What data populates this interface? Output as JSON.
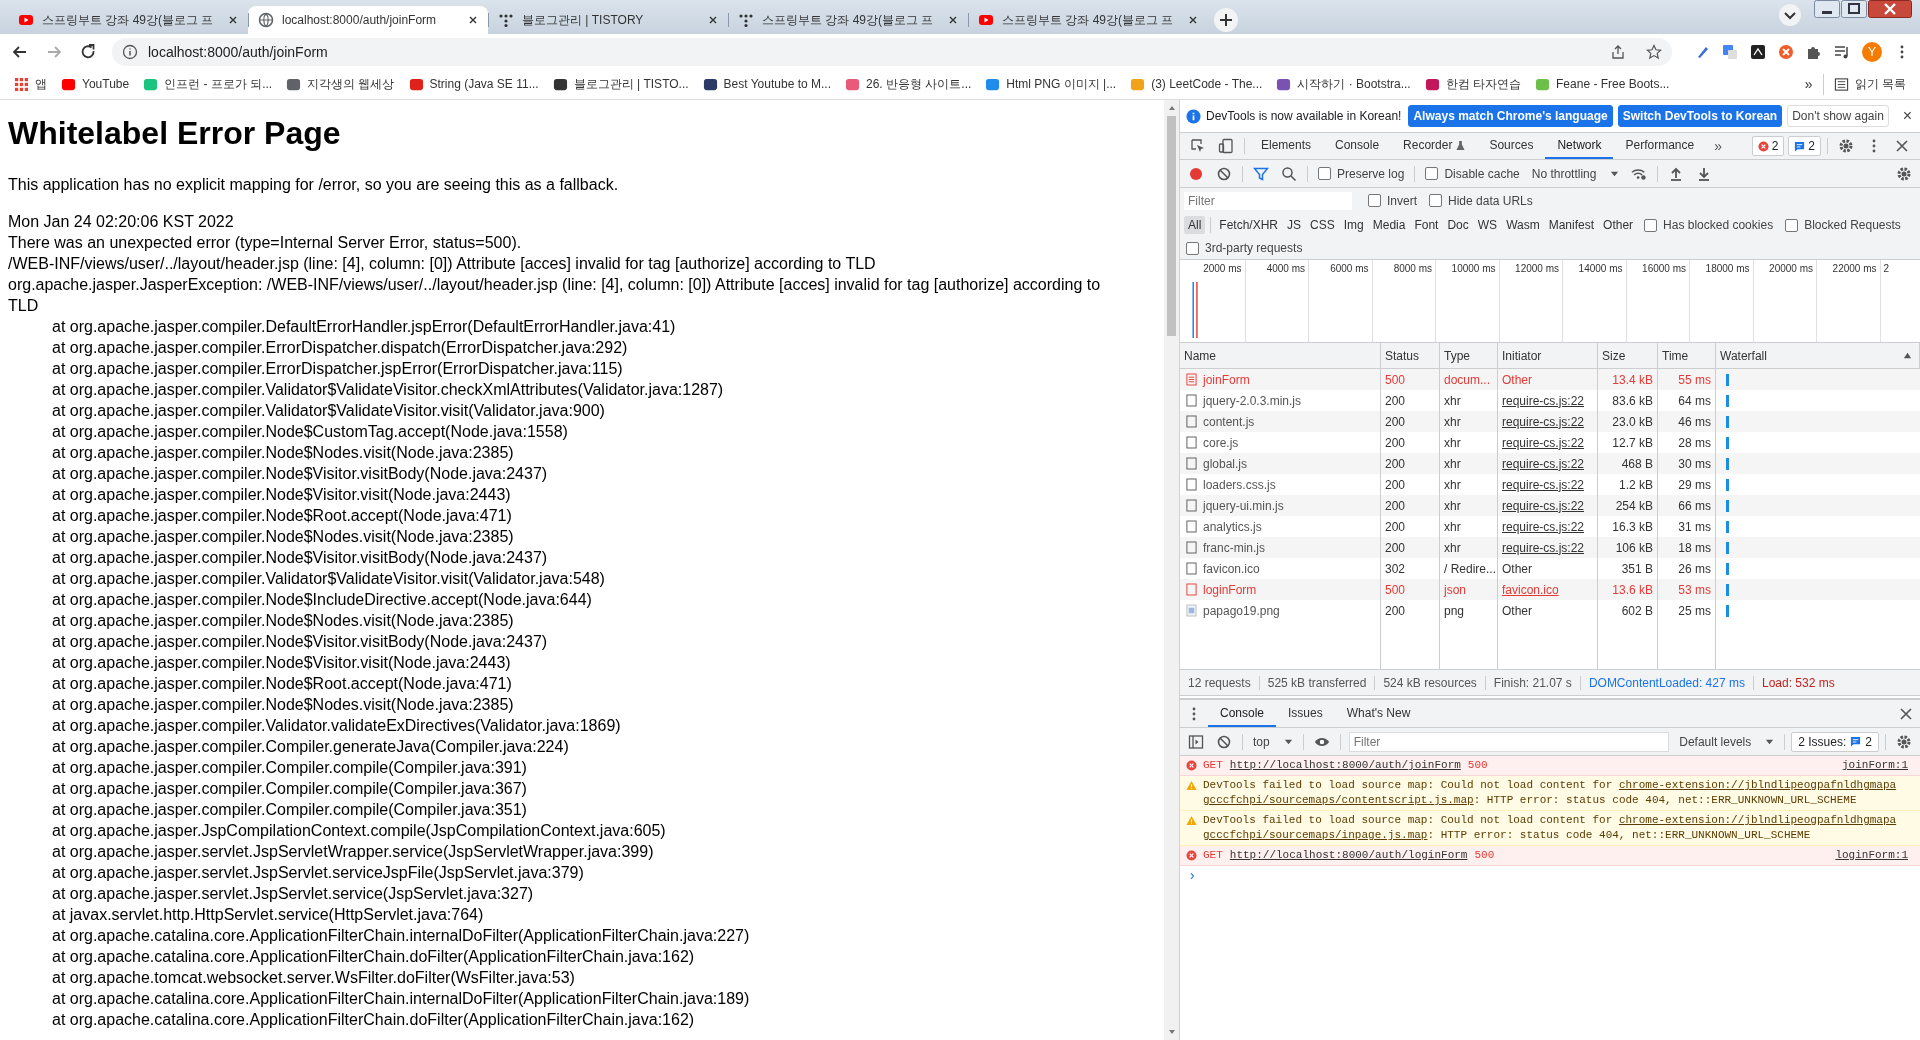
{
  "browser": {
    "tabs": [
      {
        "title": "스프링부트 강좌 49강(블로그 프",
        "kind": "youtube",
        "selected": false
      },
      {
        "title": "localhost:8000/auth/joinForm",
        "kind": "globe",
        "selected": true
      },
      {
        "title": "블로그관리 | TISTORY",
        "kind": "tistory",
        "selected": false
      },
      {
        "title": "스프링부트 강좌 49강(블로그 프",
        "kind": "tistory",
        "selected": false
      },
      {
        "title": "스프링부트 강좌 49강(블로그 프",
        "kind": "youtube",
        "selected": false
      }
    ],
    "address": "localhost:8000/auth/joinForm",
    "avatar": "Y",
    "bookmarks": [
      {
        "label": "앱",
        "kind": "apps",
        "color": "#e94235"
      },
      {
        "label": "YouTube",
        "kind": "site",
        "color": "#ff0000"
      },
      {
        "label": "인프런 - 프로가 되...",
        "kind": "site",
        "color": "#1bc47d"
      },
      {
        "label": "지각생의 웹세상",
        "kind": "site",
        "color": "#5f6368"
      },
      {
        "label": "String (Java SE 11...",
        "kind": "site",
        "color": "#e0201b"
      },
      {
        "label": "블로그관리 | TISTO...",
        "kind": "site",
        "color": "#333333"
      },
      {
        "label": "Best Youtube to M...",
        "kind": "site",
        "color": "#2b3a67"
      },
      {
        "label": "26. 반응형 사이트...",
        "kind": "site",
        "color": "#e8597a"
      },
      {
        "label": "Html PNG 이미지 |...",
        "kind": "site",
        "color": "#1f8ceb"
      },
      {
        "label": "(3) LeetCode - The...",
        "kind": "site",
        "color": "#f0a21b"
      },
      {
        "label": "시작하기 · Bootstra...",
        "kind": "site",
        "color": "#7952b3"
      },
      {
        "label": "한컴 타자연습",
        "kind": "site",
        "color": "#c2185b"
      },
      {
        "label": "Feane - Free Boots...",
        "kind": "site",
        "color": "#6cc04a"
      }
    ],
    "more": "»",
    "reading_list": "읽기 목록"
  },
  "page": {
    "heading": "Whitelabel Error Page",
    "intro": "This application has no explicit mapping for /error, so you are seeing this as a fallback.",
    "lines": [
      "Mon Jan 24 02:20:06 KST 2022",
      "There was an unexpected error (type=Internal Server Error, status=500).",
      "/WEB-INF/views/user/../layout/header.jsp (line: [4], column: [0]) Attribute [acces] invalid for tag [authorize] according to TLD",
      "org.apache.jasper.JasperException: /WEB-INF/views/user/../layout/header.jsp (line: [4], column: [0]) Attribute [acces] invalid for tag [authorize] according to TLD"
    ],
    "stack": [
      "at org.apache.jasper.compiler.DefaultErrorHandler.jspError(DefaultErrorHandler.java:41)",
      "at org.apache.jasper.compiler.ErrorDispatcher.dispatch(ErrorDispatcher.java:292)",
      "at org.apache.jasper.compiler.ErrorDispatcher.jspError(ErrorDispatcher.java:115)",
      "at org.apache.jasper.compiler.Validator$ValidateVisitor.checkXmlAttributes(Validator.java:1287)",
      "at org.apache.jasper.compiler.Validator$ValidateVisitor.visit(Validator.java:900)",
      "at org.apache.jasper.compiler.Node$CustomTag.accept(Node.java:1558)",
      "at org.apache.jasper.compiler.Node$Nodes.visit(Node.java:2385)",
      "at org.apache.jasper.compiler.Node$Visitor.visitBody(Node.java:2437)",
      "at org.apache.jasper.compiler.Node$Visitor.visit(Node.java:2443)",
      "at org.apache.jasper.compiler.Node$Root.accept(Node.java:471)",
      "at org.apache.jasper.compiler.Node$Nodes.visit(Node.java:2385)",
      "at org.apache.jasper.compiler.Node$Visitor.visitBody(Node.java:2437)",
      "at org.apache.jasper.compiler.Validator$ValidateVisitor.visit(Validator.java:548)",
      "at org.apache.jasper.compiler.Node$IncludeDirective.accept(Node.java:644)",
      "at org.apache.jasper.compiler.Node$Nodes.visit(Node.java:2385)",
      "at org.apache.jasper.compiler.Node$Visitor.visitBody(Node.java:2437)",
      "at org.apache.jasper.compiler.Node$Visitor.visit(Node.java:2443)",
      "at org.apache.jasper.compiler.Node$Root.accept(Node.java:471)",
      "at org.apache.jasper.compiler.Node$Nodes.visit(Node.java:2385)",
      "at org.apache.jasper.compiler.Validator.validateExDirectives(Validator.java:1869)",
      "at org.apache.jasper.compiler.Compiler.generateJava(Compiler.java:224)",
      "at org.apache.jasper.compiler.Compiler.compile(Compiler.java:391)",
      "at org.apache.jasper.compiler.Compiler.compile(Compiler.java:367)",
      "at org.apache.jasper.compiler.Compiler.compile(Compiler.java:351)",
      "at org.apache.jasper.JspCompilationContext.compile(JspCompilationContext.java:605)",
      "at org.apache.jasper.servlet.JspServletWrapper.service(JspServletWrapper.java:399)",
      "at org.apache.jasper.servlet.JspServlet.serviceJspFile(JspServlet.java:379)",
      "at org.apache.jasper.servlet.JspServlet.service(JspServlet.java:327)",
      "at javax.servlet.http.HttpServlet.service(HttpServlet.java:764)",
      "at org.apache.catalina.core.ApplicationFilterChain.internalDoFilter(ApplicationFilterChain.java:227)",
      "at org.apache.catalina.core.ApplicationFilterChain.doFilter(ApplicationFilterChain.java:162)",
      "at org.apache.tomcat.websocket.server.WsFilter.doFilter(WsFilter.java:53)",
      "at org.apache.catalina.core.ApplicationFilterChain.internalDoFilter(ApplicationFilterChain.java:189)",
      "at org.apache.catalina.core.ApplicationFilterChain.doFilter(ApplicationFilterChain.java:162)"
    ]
  },
  "devtools": {
    "infobar": {
      "message": "DevTools is now available in Korean!",
      "buttons": [
        {
          "label": "Always match Chrome's language",
          "kind": "primary"
        },
        {
          "label": "Switch DevTools to Korean",
          "kind": "primary"
        },
        {
          "label": "Don't show again",
          "kind": "plain"
        }
      ],
      "close": "×"
    },
    "tabs": [
      {
        "label": "Elements",
        "selected": false
      },
      {
        "label": "Console",
        "selected": false
      },
      {
        "label": "Recorder",
        "selected": false
      },
      {
        "label": "Sources",
        "selected": false
      },
      {
        "label": "Network",
        "selected": true
      },
      {
        "label": "Performance",
        "selected": false
      }
    ],
    "tabs_more": "»",
    "error_count": "2",
    "message_count": "2",
    "toolbar": {
      "preserve_log": {
        "label": "Preserve log",
        "checked": false
      },
      "disable_cache": {
        "label": "Disable cache",
        "checked": false
      },
      "throttling": "No throttling"
    },
    "filter": {
      "placeholder": "Filter",
      "options": [
        {
          "label": "Invert",
          "checked": false
        },
        {
          "label": "Hide data URLs",
          "checked": false
        }
      ]
    },
    "types": [
      {
        "label": "All",
        "selected": true
      },
      {
        "label": "Fetch/XHR",
        "selected": false
      },
      {
        "label": "JS",
        "selected": false
      },
      {
        "label": "CSS",
        "selected": false
      },
      {
        "label": "Img",
        "selected": false
      },
      {
        "label": "Media",
        "selected": false
      },
      {
        "label": "Font",
        "selected": false
      },
      {
        "label": "Doc",
        "selected": false
      },
      {
        "label": "WS",
        "selected": false
      },
      {
        "label": "Wasm",
        "selected": false
      },
      {
        "label": "Manifest",
        "selected": false
      },
      {
        "label": "Other",
        "selected": false
      }
    ],
    "type_options": [
      {
        "label": "Has blocked cookies",
        "checked": false
      },
      {
        "label": "Blocked Requests",
        "checked": false
      }
    ],
    "third_party": {
      "label": "3rd-party requests",
      "checked": false
    },
    "overview_ticks": [
      "2000 ms",
      "4000 ms",
      "6000 ms",
      "8000 ms",
      "10000 ms",
      "12000 ms",
      "14000 ms",
      "16000 ms",
      "18000 ms",
      "20000 ms",
      "22000 ms",
      "2"
    ],
    "table": {
      "columns": [
        "Name",
        "Status",
        "Type",
        "Initiator",
        "Size",
        "Time",
        "Waterfall"
      ],
      "rows": [
        {
          "name": "joinForm",
          "status": "500",
          "type": "docum...",
          "initiator": "Other",
          "initiator_link": false,
          "size": "13.4 kB",
          "time": "55 ms",
          "error": true,
          "kind": "document"
        },
        {
          "name": "jquery-2.0.3.min.js",
          "status": "200",
          "type": "xhr",
          "initiator": "require-cs.js:22",
          "initiator_link": true,
          "size": "83.6 kB",
          "time": "64 ms",
          "error": false,
          "kind": "file"
        },
        {
          "name": "content.js",
          "status": "200",
          "type": "xhr",
          "initiator": "require-cs.js:22",
          "initiator_link": true,
          "size": "23.0 kB",
          "time": "46 ms",
          "error": false,
          "kind": "file"
        },
        {
          "name": "core.js",
          "status": "200",
          "type": "xhr",
          "initiator": "require-cs.js:22",
          "initiator_link": true,
          "size": "12.7 kB",
          "time": "28 ms",
          "error": false,
          "kind": "file"
        },
        {
          "name": "global.js",
          "status": "200",
          "type": "xhr",
          "initiator": "require-cs.js:22",
          "initiator_link": true,
          "size": "468 B",
          "time": "30 ms",
          "error": false,
          "kind": "file"
        },
        {
          "name": "loaders.css.js",
          "status": "200",
          "type": "xhr",
          "initiator": "require-cs.js:22",
          "initiator_link": true,
          "size": "1.2 kB",
          "time": "29 ms",
          "error": false,
          "kind": "file"
        },
        {
          "name": "jquery-ui.min.js",
          "status": "200",
          "type": "xhr",
          "initiator": "require-cs.js:22",
          "initiator_link": true,
          "size": "254 kB",
          "time": "66 ms",
          "error": false,
          "kind": "file"
        },
        {
          "name": "analytics.js",
          "status": "200",
          "type": "xhr",
          "initiator": "require-cs.js:22",
          "initiator_link": true,
          "size": "16.3 kB",
          "time": "31 ms",
          "error": false,
          "kind": "file"
        },
        {
          "name": "franc-min.js",
          "status": "200",
          "type": "xhr",
          "initiator": "require-cs.js:22",
          "initiator_link": true,
          "size": "106 kB",
          "time": "18 ms",
          "error": false,
          "kind": "file"
        },
        {
          "name": "favicon.ico",
          "status": "302",
          "type": "/ Redire...",
          "initiator": "Other",
          "initiator_link": false,
          "size": "351 B",
          "time": "26 ms",
          "error": false,
          "kind": "file"
        },
        {
          "name": "loginForm",
          "status": "500",
          "type": "json",
          "initiator": "favicon.ico",
          "initiator_link": true,
          "size": "13.6 kB",
          "time": "53 ms",
          "error": true,
          "kind": "file"
        },
        {
          "name": "papago19.png",
          "status": "200",
          "type": "png",
          "initiator": "Other",
          "initiator_link": false,
          "size": "602 B",
          "time": "25 ms",
          "error": false,
          "kind": "image"
        }
      ]
    },
    "summary": [
      {
        "text": "12 requests",
        "kind": "plain"
      },
      {
        "text": "525 kB transferred",
        "kind": "plain"
      },
      {
        "text": "524 kB resources",
        "kind": "plain"
      },
      {
        "text": "Finish: 21.07 s",
        "kind": "plain"
      },
      {
        "text": "DOMContentLoaded: 427 ms",
        "kind": "dom"
      },
      {
        "text": "Load: 532 ms",
        "kind": "load"
      }
    ],
    "drawer_tabs": [
      {
        "label": "Console",
        "selected": true
      },
      {
        "label": "Issues",
        "selected": false
      },
      {
        "label": "What's New",
        "selected": false
      }
    ],
    "console_toolbar": {
      "context": "top",
      "filter_placeholder": "Filter",
      "levels": "Default levels",
      "issues": "2 Issues:",
      "issues_count": "2"
    },
    "messages": [
      {
        "kind": "error",
        "method": "GET",
        "url": "http://localhost:8000/auth/joinForm",
        "status": "500",
        "source": "joinForm:1"
      },
      {
        "kind": "warning",
        "text": "DevTools failed to load source map: Could not load content for",
        "url_lines": [
          "chrome-extension://jblndlipeogpafnldhgmapa",
          "gcccfchpi/sourcemaps/contentscript.js.map"
        ],
        "detail": ": HTTP error: status code 404, net::ERR_UNKNOWN_URL_SCHEME"
      },
      {
        "kind": "warning",
        "text": "DevTools failed to load source map: Could not load content for",
        "url_lines": [
          "chrome-extension://jblndlipeogpafnldhgmapa",
          "gcccfchpi/sourcemaps/inpage.js.map"
        ],
        "detail": ": HTTP error: status code 404, net::ERR_UNKNOWN_URL_SCHEME"
      },
      {
        "kind": "error",
        "method": "GET",
        "url": "http://localhost:8000/auth/loginForm",
        "status": "500",
        "source": "loginForm:1"
      }
    ],
    "prompt": "›"
  }
}
